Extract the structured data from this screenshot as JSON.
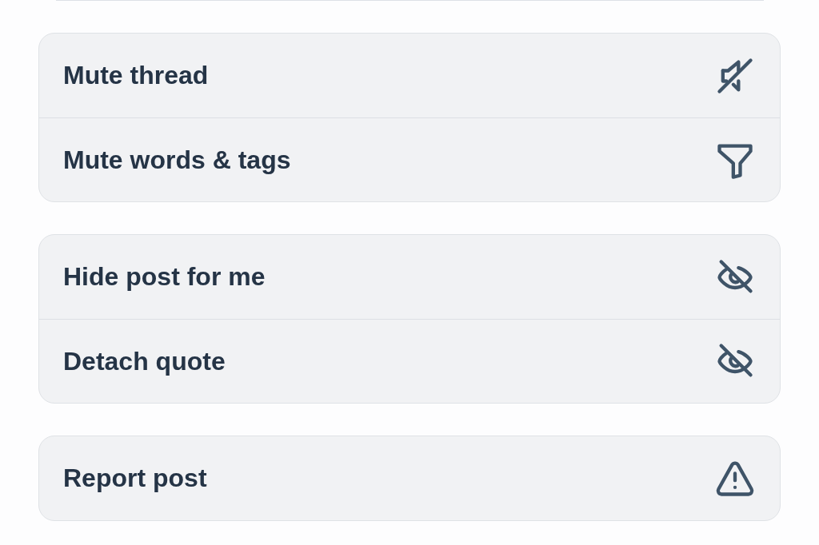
{
  "menu_groups": [
    {
      "items": [
        {
          "label": "Mute thread",
          "kind": "mute"
        },
        {
          "label": "Mute words & tags",
          "kind": "filter"
        }
      ]
    },
    {
      "items": [
        {
          "label": "Hide post for me",
          "kind": "hide"
        },
        {
          "label": "Detach quote",
          "kind": "hide"
        }
      ]
    },
    {
      "items": [
        {
          "label": "Report post",
          "kind": "warning"
        }
      ]
    }
  ]
}
